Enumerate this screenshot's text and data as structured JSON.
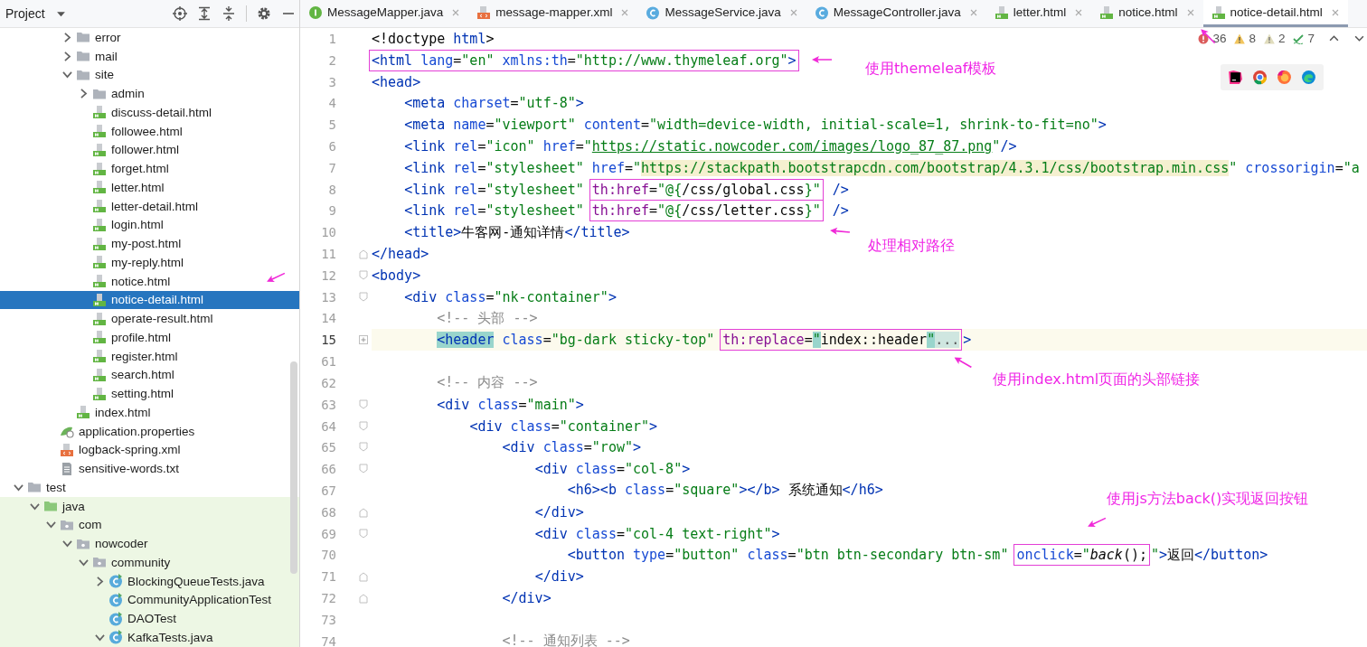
{
  "project_panel": {
    "title": "Project"
  },
  "tree": [
    {
      "children": [
        {
          "children": [
            {
              "children": [
                {
                  "name": "error",
                  "kind": "folder",
                  "expanded": false,
                  "selected": false
                },
                {
                  "name": "mail",
                  "kind": "folder",
                  "expanded": false,
                  "selected": false
                },
                {
                  "name": "site",
                  "kind": "folder",
                  "expanded": true,
                  "selected": false,
                  "children": [
                    {
                      "name": "admin",
                      "kind": "folder",
                      "expanded": false,
                      "selected": false
                    },
                    {
                      "name": "discuss-detail.html",
                      "kind": "html",
                      "selected": false
                    },
                    {
                      "name": "followee.html",
                      "kind": "html",
                      "selected": false
                    },
                    {
                      "name": "follower.html",
                      "kind": "html",
                      "selected": false
                    },
                    {
                      "name": "forget.html",
                      "kind": "html",
                      "selected": false
                    },
                    {
                      "name": "letter.html",
                      "kind": "html",
                      "selected": false
                    },
                    {
                      "name": "letter-detail.html",
                      "kind": "html",
                      "selected": false
                    },
                    {
                      "name": "login.html",
                      "kind": "html",
                      "selected": false
                    },
                    {
                      "name": "my-post.html",
                      "kind": "html",
                      "selected": false
                    },
                    {
                      "name": "my-reply.html",
                      "kind": "html",
                      "selected": false
                    },
                    {
                      "name": "notice.html",
                      "kind": "html",
                      "selected": false
                    },
                    {
                      "name": "notice-detail.html",
                      "kind": "html",
                      "selected": true
                    },
                    {
                      "name": "operate-result.html",
                      "kind": "html",
                      "selected": false
                    },
                    {
                      "name": "profile.html",
                      "kind": "html",
                      "selected": false
                    },
                    {
                      "name": "register.html",
                      "kind": "html",
                      "selected": false
                    },
                    {
                      "name": "search.html",
                      "kind": "html",
                      "selected": false
                    },
                    {
                      "name": "setting.html",
                      "kind": "html",
                      "selected": false
                    }
                  ]
                },
                {
                  "name": "index.html",
                  "kind": "html",
                  "selected": false
                }
              ]
            },
            {
              "name": "application.properties",
              "kind": "properties",
              "selected": false
            },
            {
              "name": "logback-spring.xml",
              "kind": "xml",
              "selected": false
            },
            {
              "name": "sensitive-words.txt",
              "kind": "text",
              "selected": false
            }
          ]
        }
      ]
    },
    {
      "name": "test",
      "kind": "folder",
      "expanded": true,
      "selected": false,
      "children": [
        {
          "name": "java",
          "kind": "test-source-folder",
          "expanded": true,
          "selected": false,
          "children": [
            {
              "name": "com",
              "kind": "package",
              "expanded": true,
              "selected": false,
              "children": [
                {
                  "name": "nowcoder",
                  "kind": "package",
                  "expanded": true,
                  "selected": false,
                  "children": [
                    {
                      "name": "community",
                      "kind": "package",
                      "expanded": true,
                      "selected": false,
                      "children": [
                        {
                          "name": "BlockingQueueTests.java",
                          "kind": "test-class",
                          "expanded": false,
                          "selected": false
                        },
                        {
                          "name": "CommunityApplicationTest",
                          "kind": "test-class",
                          "selected": false
                        },
                        {
                          "name": "DAOTest",
                          "kind": "test-class",
                          "selected": false
                        },
                        {
                          "name": "KafkaTests.java",
                          "kind": "test-class",
                          "expanded": true,
                          "selected": false
                        }
                      ]
                    }
                  ]
                }
              ]
            }
          ]
        }
      ]
    }
  ],
  "tabs": [
    {
      "label": "MessageMapper.java",
      "kind": "interface",
      "selected": false
    },
    {
      "label": "message-mapper.xml",
      "kind": "xml",
      "selected": false
    },
    {
      "label": "MessageService.java",
      "kind": "class",
      "selected": false
    },
    {
      "label": "MessageController.java",
      "kind": "class",
      "selected": false
    },
    {
      "label": "letter.html",
      "kind": "html",
      "selected": false
    },
    {
      "label": "notice.html",
      "kind": "html",
      "selected": false
    },
    {
      "label": "notice-detail.html",
      "kind": "html",
      "selected": true
    }
  ],
  "inspections": [
    {
      "kind": "error",
      "count": "36"
    },
    {
      "kind": "warning",
      "count": "8"
    },
    {
      "kind": "weak-warning",
      "count": "2"
    },
    {
      "kind": "typo",
      "count": "7"
    }
  ],
  "code_lines": [
    {
      "number": "1",
      "current": false,
      "tokens": [
        {
          "kind": "plain",
          "text": "<!doctype "
        },
        {
          "kind": "tag",
          "text": "html"
        },
        {
          "kind": "plain",
          "text": ">"
        }
      ]
    },
    {
      "number": "2",
      "current": false,
      "tokens": [
        {
          "kind": "box",
          "tokens": [
            {
              "kind": "tag",
              "text": "<html"
            },
            {
              "kind": "attr",
              "text": " lang"
            },
            {
              "kind": "plain",
              "text": "="
            },
            {
              "kind": "str",
              "text": "\"en\""
            },
            {
              "kind": "attr",
              "text": " xmlns:th"
            },
            {
              "kind": "plain",
              "text": "="
            },
            {
              "kind": "str",
              "text": "\"http://www.thymeleaf.org\""
            },
            {
              "kind": "tag",
              "text": ">"
            }
          ]
        }
      ]
    },
    {
      "number": "3",
      "current": false,
      "tokens": [
        {
          "kind": "tag",
          "text": "<head>"
        }
      ]
    },
    {
      "number": "4",
      "current": false,
      "tokens": [
        {
          "kind": "tag",
          "text": "    <meta"
        },
        {
          "kind": "attr",
          "text": " charset"
        },
        {
          "kind": "plain",
          "text": "="
        },
        {
          "kind": "str",
          "text": "\"utf-8\""
        },
        {
          "kind": "tag",
          "text": ">"
        }
      ]
    },
    {
      "number": "5",
      "current": false,
      "tokens": [
        {
          "kind": "tag",
          "text": "    <meta"
        },
        {
          "kind": "attr",
          "text": " name"
        },
        {
          "kind": "plain",
          "text": "="
        },
        {
          "kind": "str",
          "text": "\"viewport\""
        },
        {
          "kind": "attr",
          "text": " content"
        },
        {
          "kind": "plain",
          "text": "="
        },
        {
          "kind": "str",
          "text": "\"width=device-width, initial-scale=1, shrink-to-fit=no\""
        },
        {
          "kind": "tag",
          "text": ">"
        }
      ]
    },
    {
      "number": "6",
      "current": false,
      "tokens": [
        {
          "kind": "tag",
          "text": "    <link"
        },
        {
          "kind": "attr",
          "text": " rel"
        },
        {
          "kind": "plain",
          "text": "="
        },
        {
          "kind": "str",
          "text": "\"icon\""
        },
        {
          "kind": "attr",
          "text": " href"
        },
        {
          "kind": "plain",
          "text": "="
        },
        {
          "kind": "str",
          "text": "\""
        },
        {
          "kind": "link",
          "text": "https://static.nowcoder.com/images/logo_87_87.png"
        },
        {
          "kind": "str",
          "text": "\""
        },
        {
          "kind": "tag",
          "text": "/>"
        }
      ]
    },
    {
      "number": "7",
      "current": false,
      "tokens": [
        {
          "kind": "tag",
          "text": "    <link"
        },
        {
          "kind": "attr",
          "text": " rel"
        },
        {
          "kind": "plain",
          "text": "="
        },
        {
          "kind": "str",
          "text": "\"stylesheet\""
        },
        {
          "kind": "attr",
          "text": " href"
        },
        {
          "kind": "plain",
          "text": "="
        },
        {
          "kind": "str",
          "text": "\""
        },
        {
          "kind": "linkbg",
          "text": "https://stackpath.bootstrapcdn.com/bootstrap/4.3.1/css/bootstrap.min.css"
        },
        {
          "kind": "str",
          "text": "\""
        },
        {
          "kind": "attr",
          "text": " crossorigin"
        },
        {
          "kind": "plain",
          "text": "="
        },
        {
          "kind": "str",
          "text": "\"a"
        }
      ]
    },
    {
      "number": "8",
      "current": false,
      "tokens": [
        {
          "kind": "tag",
          "text": "    <link"
        },
        {
          "kind": "attr",
          "text": " rel"
        },
        {
          "kind": "plain",
          "text": "="
        },
        {
          "kind": "str",
          "text": "\"stylesheet\" "
        },
        {
          "kind": "box",
          "tokens": [
            {
              "kind": "th",
              "text": "th:href"
            },
            {
              "kind": "plain",
              "text": "="
            },
            {
              "kind": "str",
              "text": "\"@{"
            },
            {
              "kind": "plain",
              "text": "/css/global.css"
            },
            {
              "kind": "str",
              "text": "}\""
            }
          ]
        },
        {
          "kind": "tag",
          "text": " />"
        }
      ]
    },
    {
      "number": "9",
      "current": false,
      "tokens": [
        {
          "kind": "tag",
          "text": "    <link"
        },
        {
          "kind": "attr",
          "text": " rel"
        },
        {
          "kind": "plain",
          "text": "="
        },
        {
          "kind": "str",
          "text": "\"stylesheet\" "
        },
        {
          "kind": "box",
          "tokens": [
            {
              "kind": "th",
              "text": "th:href"
            },
            {
              "kind": "plain",
              "text": "="
            },
            {
              "kind": "str",
              "text": "\"@{"
            },
            {
              "kind": "plain",
              "text": "/css/letter.css"
            },
            {
              "kind": "str",
              "text": "}\""
            }
          ]
        },
        {
          "kind": "tag",
          "text": " />"
        }
      ]
    },
    {
      "number": "10",
      "current": false,
      "tokens": [
        {
          "kind": "tag",
          "text": "    <title>"
        },
        {
          "kind": "plain",
          "text": "牛客网-通知详情"
        },
        {
          "kind": "tag",
          "text": "</title>"
        }
      ]
    },
    {
      "number": "11",
      "current": false,
      "fold": {
        "kind": "close"
      },
      "tokens": [
        {
          "kind": "tag",
          "text": "</head>"
        }
      ]
    },
    {
      "number": "12",
      "current": false,
      "fold": {
        "kind": "open"
      },
      "tokens": [
        {
          "kind": "tag",
          "text": "<body>"
        }
      ]
    },
    {
      "number": "13",
      "current": false,
      "fold": {
        "kind": "open"
      },
      "tokens": [
        {
          "kind": "tag",
          "text": "    <div"
        },
        {
          "kind": "attr",
          "text": " class"
        },
        {
          "kind": "plain",
          "text": "="
        },
        {
          "kind": "str",
          "text": "\"nk-container\""
        },
        {
          "kind": "tag",
          "text": ">"
        }
      ]
    },
    {
      "number": "14",
      "current": false,
      "tokens": [
        {
          "kind": "comment",
          "text": "        <!-- 头部 -->"
        }
      ]
    },
    {
      "number": "15",
      "current": true,
      "fold": {
        "kind": "collapsed"
      },
      "tokens": [
        {
          "kind": "match",
          "text": "        <header"
        },
        {
          "kind": "attr",
          "text": " class"
        },
        {
          "kind": "plain",
          "text": "="
        },
        {
          "kind": "str",
          "text": "\"bg-dark sticky-top\" "
        },
        {
          "kind": "box",
          "tokens": [
            {
              "kind": "th",
              "text": "th:replace"
            },
            {
              "kind": "plain",
              "text": "="
            },
            {
              "kind": "matchstr",
              "text": "\""
            },
            {
              "kind": "plain",
              "text": "index::header"
            },
            {
              "kind": "matchstr",
              "text": "\""
            },
            {
              "kind": "fold",
              "text": "..."
            }
          ]
        },
        {
          "kind": "tag",
          "text": ">"
        }
      ]
    },
    {
      "number": "61",
      "current": false
    },
    {
      "number": "62",
      "current": false,
      "tokens": [
        {
          "kind": "comment",
          "text": "        <!-- 内容 -->"
        }
      ]
    },
    {
      "number": "63",
      "current": false,
      "fold": {
        "kind": "open"
      },
      "tokens": [
        {
          "kind": "tag",
          "text": "        <div"
        },
        {
          "kind": "attr",
          "text": " class"
        },
        {
          "kind": "plain",
          "text": "="
        },
        {
          "kind": "str",
          "text": "\"main\""
        },
        {
          "kind": "tag",
          "text": ">"
        }
      ]
    },
    {
      "number": "64",
      "current": false,
      "fold": {
        "kind": "open"
      },
      "tokens": [
        {
          "kind": "tag",
          "text": "            <div"
        },
        {
          "kind": "attr",
          "text": " class"
        },
        {
          "kind": "plain",
          "text": "="
        },
        {
          "kind": "str",
          "text": "\"container\""
        },
        {
          "kind": "tag",
          "text": ">"
        }
      ]
    },
    {
      "number": "65",
      "current": false,
      "fold": {
        "kind": "open"
      },
      "tokens": [
        {
          "kind": "tag",
          "text": "                <div"
        },
        {
          "kind": "attr",
          "text": " class"
        },
        {
          "kind": "plain",
          "text": "="
        },
        {
          "kind": "str",
          "text": "\"row\""
        },
        {
          "kind": "tag",
          "text": ">"
        }
      ]
    },
    {
      "number": "66",
      "current": false,
      "fold": {
        "kind": "open"
      },
      "tokens": [
        {
          "kind": "tag",
          "text": "                    <div"
        },
        {
          "kind": "attr",
          "text": " class"
        },
        {
          "kind": "plain",
          "text": "="
        },
        {
          "kind": "str",
          "text": "\"col-8\""
        },
        {
          "kind": "tag",
          "text": ">"
        }
      ]
    },
    {
      "number": "67",
      "current": false,
      "tokens": [
        {
          "kind": "tag",
          "text": "                        <h6><b"
        },
        {
          "kind": "attr",
          "text": " class"
        },
        {
          "kind": "plain",
          "text": "="
        },
        {
          "kind": "str",
          "text": "\"square\""
        },
        {
          "kind": "tag",
          "text": "></b>"
        },
        {
          "kind": "plain",
          "text": " 系统通知"
        },
        {
          "kind": "tag",
          "text": "</h6>"
        }
      ]
    },
    {
      "number": "68",
      "current": false,
      "fold": {
        "kind": "close"
      },
      "tokens": [
        {
          "kind": "tag",
          "text": "                    </div>"
        }
      ]
    },
    {
      "number": "69",
      "current": false,
      "fold": {
        "kind": "open"
      },
      "tokens": [
        {
          "kind": "tag",
          "text": "                    <div"
        },
        {
          "kind": "attr",
          "text": " class"
        },
        {
          "kind": "plain",
          "text": "="
        },
        {
          "kind": "str",
          "text": "\"col-4 text-right\""
        },
        {
          "kind": "tag",
          "text": ">"
        }
      ]
    },
    {
      "number": "70",
      "current": false,
      "tokens": [
        {
          "kind": "tag",
          "text": "                        <button"
        },
        {
          "kind": "attr",
          "text": " type"
        },
        {
          "kind": "plain",
          "text": "="
        },
        {
          "kind": "str",
          "text": "\"button\""
        },
        {
          "kind": "attr",
          "text": " class"
        },
        {
          "kind": "plain",
          "text": "="
        },
        {
          "kind": "str",
          "text": "\"btn btn-secondary btn-sm\" "
        },
        {
          "kind": "box",
          "tokens": [
            {
              "kind": "attr",
              "text": "onclick"
            },
            {
              "kind": "plain",
              "text": "="
            },
            {
              "kind": "str",
              "text": "\""
            },
            {
              "kind": "ital",
              "text": "back"
            },
            {
              "kind": "plain",
              "text": "();"
            }
          ]
        },
        {
          "kind": "str",
          "text": "\""
        },
        {
          "kind": "tag",
          "text": ">"
        },
        {
          "kind": "plain",
          "text": "返回"
        },
        {
          "kind": "tag",
          "text": "</button>"
        }
      ]
    },
    {
      "number": "71",
      "current": false,
      "fold": {
        "kind": "close"
      },
      "tokens": [
        {
          "kind": "tag",
          "text": "                    </div>"
        }
      ]
    },
    {
      "number": "72",
      "current": false,
      "fold": {
        "kind": "close"
      },
      "tokens": [
        {
          "kind": "tag",
          "text": "                </div>"
        }
      ]
    },
    {
      "number": "73",
      "current": false
    },
    {
      "number": "74",
      "current": false,
      "tokens": [
        {
          "kind": "comment",
          "text": "                <!-- 通知列表 -->"
        }
      ]
    }
  ],
  "annotations": [
    {
      "text": "使用themeleaf模板"
    },
    {
      "text": "处理相对路径"
    },
    {
      "text": "使用index.html页面的头部链接"
    },
    {
      "text": "使用js方法back()实现返回按钮"
    }
  ]
}
